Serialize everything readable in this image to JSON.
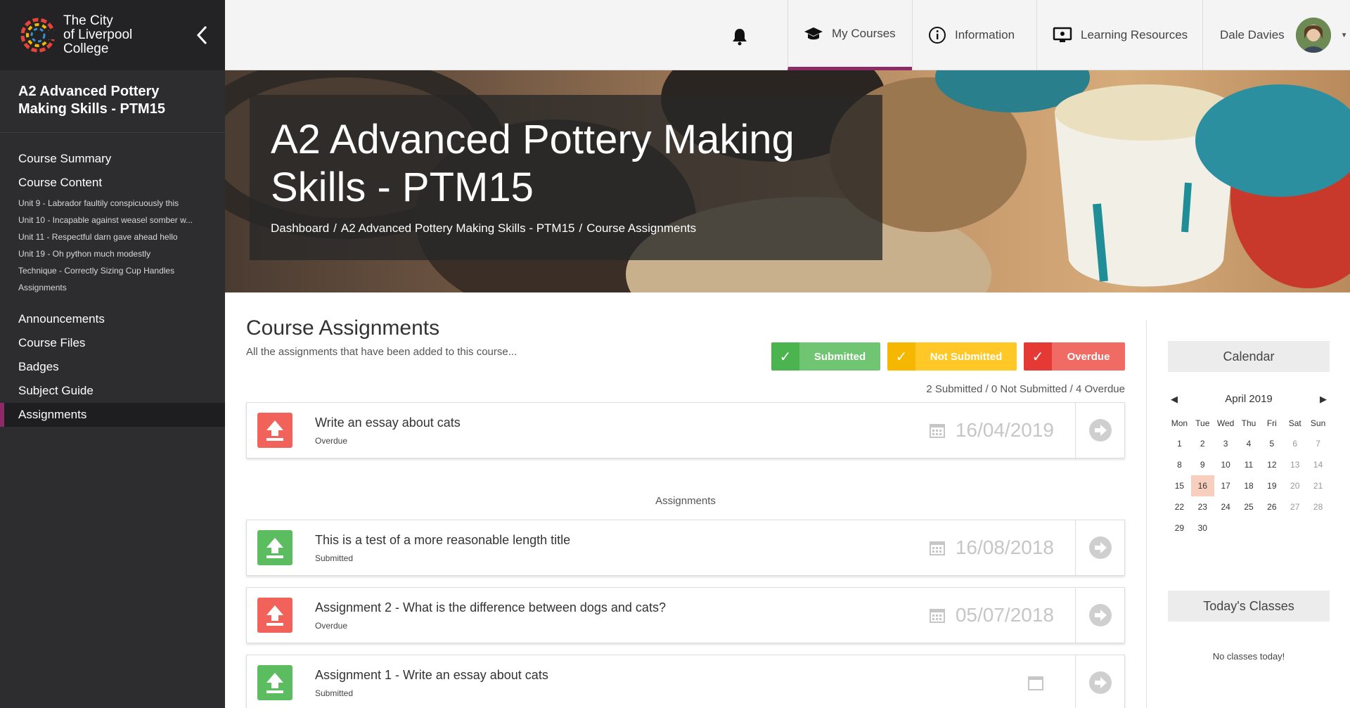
{
  "sidebar": {
    "logo_text": [
      "The City",
      "of Liverpool",
      "College"
    ],
    "course_title": "A2 Advanced Pottery Making Skills - PTM15",
    "nav": {
      "course_summary": "Course Summary",
      "course_content": "Course Content",
      "sub_items": [
        "Unit 9 - Labrador faultily conspicuously this",
        "Unit 10 - Incapable against weasel somber w...",
        "Unit 11 - Respectful darn gave ahead hello",
        "Unit 19 - Oh python much modestly",
        "Technique - Correctly Sizing Cup Handles",
        "Assignments"
      ],
      "announcements": "Announcements",
      "course_files": "Course Files",
      "badges": "Badges",
      "subject_guide": "Subject Guide",
      "assignments": "Assignments"
    }
  },
  "topbar": {
    "my_courses": "My Courses",
    "information": "Information",
    "learning_resources": "Learning Resources",
    "user_name": "Dale Davies",
    "accent": "#8e2a67"
  },
  "hero": {
    "title": "A2 Advanced Pottery Making Skills - PTM15",
    "breadcrumbs": [
      "Dashboard",
      "A2 Advanced Pottery Making Skills - PTM15",
      "Course Assignments"
    ]
  },
  "main": {
    "heading": "Course Assignments",
    "subheading": "All the assignments that have been added to this course...",
    "legend": {
      "submitted": "Submitted",
      "not_submitted": "Not Submitted",
      "overdue": "Overdue",
      "check": "✓"
    },
    "counts": "2 Submitted / 0 Not Submitted / 4 Overdue",
    "featured": {
      "title": "Write an essay about cats",
      "status": "Overdue",
      "date": "16/04/2019",
      "state": "overdue"
    },
    "section_label": "Assignments",
    "assignments": [
      {
        "title": "This is a test of a more reasonable length title",
        "status": "Submitted",
        "date": "16/08/2018",
        "state": "submitted"
      },
      {
        "title": "Assignment 2 - What is the difference between dogs and cats?",
        "status": "Overdue",
        "date": "05/07/2018",
        "state": "overdue"
      },
      {
        "title": "Assignment 1 - Write an essay about cats",
        "status": "Submitted",
        "date": "",
        "state": "submitted"
      }
    ]
  },
  "calendar": {
    "title": "Calendar",
    "month": "April 2019",
    "prev": "◀",
    "next": "▶",
    "days_of_week": [
      "Mon",
      "Tue",
      "Wed",
      "Thu",
      "Fri",
      "Sat",
      "Sun"
    ],
    "days": [
      "1",
      "2",
      "3",
      "4",
      "5",
      "6",
      "7",
      "8",
      "9",
      "10",
      "11",
      "12",
      "13",
      "14",
      "15",
      "16",
      "17",
      "18",
      "19",
      "20",
      "21",
      "22",
      "23",
      "24",
      "25",
      "26",
      "27",
      "28",
      "29",
      "30"
    ],
    "today": "16"
  },
  "classes": {
    "title": "Today's Classes",
    "empty": "No classes today!"
  }
}
